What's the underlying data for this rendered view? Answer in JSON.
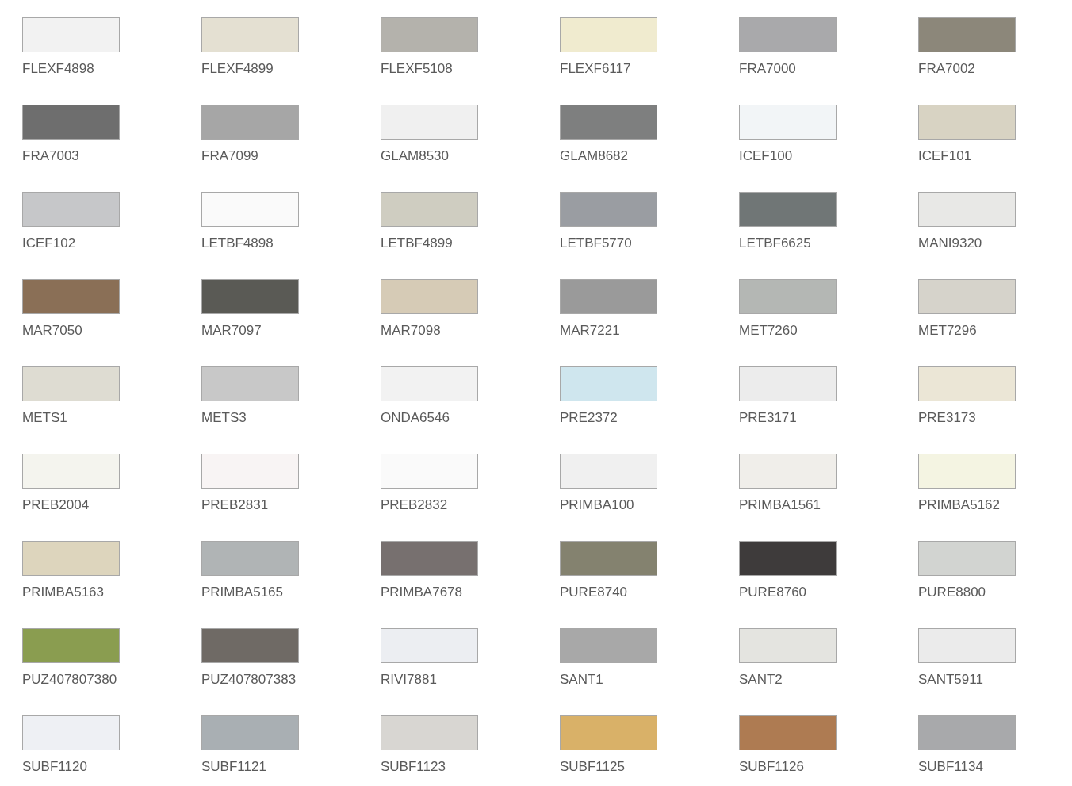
{
  "swatches": [
    {
      "code": "FLEXF4898",
      "color": "#f2f2f2"
    },
    {
      "code": "FLEXF4899",
      "color": "#e4e0d2"
    },
    {
      "code": "FLEXF5108",
      "color": "#b4b2ac"
    },
    {
      "code": "FLEXF6117",
      "color": "#f0ebcf"
    },
    {
      "code": "FRA7000",
      "color": "#a9a9ab"
    },
    {
      "code": "FRA7002",
      "color": "#8c877a"
    },
    {
      "code": "FRA7003",
      "color": "#6e6e6e"
    },
    {
      "code": "FRA7099",
      "color": "#a6a6a6"
    },
    {
      "code": "GLAM8530",
      "color": "#f0f0f0"
    },
    {
      "code": "GLAM8682",
      "color": "#7e7f7f"
    },
    {
      "code": "ICEF100",
      "color": "#f2f5f7"
    },
    {
      "code": "ICEF101",
      "color": "#d8d3c3"
    },
    {
      "code": "ICEF102",
      "color": "#c6c7c9"
    },
    {
      "code": "LETBF4898",
      "color": "#fafafa"
    },
    {
      "code": "LETBF4899",
      "color": "#cfcdc1"
    },
    {
      "code": "LETBF5770",
      "color": "#9a9da2"
    },
    {
      "code": "LETBF6625",
      "color": "#707676"
    },
    {
      "code": "MANI9320",
      "color": "#e8e8e6"
    },
    {
      "code": "MAR7050",
      "color": "#8a6f56"
    },
    {
      "code": "MAR7097",
      "color": "#5a5a55"
    },
    {
      "code": "MAR7098",
      "color": "#d6cbb6"
    },
    {
      "code": "MAR7221",
      "color": "#9a9a9a"
    },
    {
      "code": "MET7260",
      "color": "#b4b7b4"
    },
    {
      "code": "MET7296",
      "color": "#d6d3cb"
    },
    {
      "code": "METS1",
      "color": "#dedcd2"
    },
    {
      "code": "METS3",
      "color": "#c8c8c8"
    },
    {
      "code": "ONDA6546",
      "color": "#f2f2f2"
    },
    {
      "code": "PRE2372",
      "color": "#cfe6ee"
    },
    {
      "code": "PRE3171",
      "color": "#ececec"
    },
    {
      "code": "PRE3173",
      "color": "#ebe6d6"
    },
    {
      "code": "PREB2004",
      "color": "#f4f4ee"
    },
    {
      "code": "PREB2831",
      "color": "#f8f4f4"
    },
    {
      "code": "PREB2832",
      "color": "#fafafa"
    },
    {
      "code": "PRIMBA100",
      "color": "#f0f0f0"
    },
    {
      "code": "PRIMBA1561",
      "color": "#f0eeea"
    },
    {
      "code": "PRIMBA5162",
      "color": "#f4f4e2"
    },
    {
      "code": "PRIMBA5163",
      "color": "#ddd5bd"
    },
    {
      "code": "PRIMBA5165",
      "color": "#b0b4b5"
    },
    {
      "code": "PRIMBA7678",
      "color": "#77706f"
    },
    {
      "code": "PURE8740",
      "color": "#84826f"
    },
    {
      "code": "PURE8760",
      "color": "#3e3b3b"
    },
    {
      "code": "PURE8800",
      "color": "#d2d4d1"
    },
    {
      "code": "PUZ407807380",
      "color": "#8a9d50"
    },
    {
      "code": "PUZ407807383",
      "color": "#6f6a65"
    },
    {
      "code": "RIVI7881",
      "color": "#eceef2"
    },
    {
      "code": "SANT1",
      "color": "#a8a8a8"
    },
    {
      "code": "SANT2",
      "color": "#e4e4e0"
    },
    {
      "code": "SANT5911",
      "color": "#ebebeb"
    },
    {
      "code": "SUBF1120",
      "color": "#eef0f4"
    },
    {
      "code": "SUBF1121",
      "color": "#a9afb3"
    },
    {
      "code": "SUBF1123",
      "color": "#d8d6d2"
    },
    {
      "code": "SUBF1125",
      "color": "#d9b168"
    },
    {
      "code": "SUBF1126",
      "color": "#ae7b52"
    },
    {
      "code": "SUBF1134",
      "color": "#a8a9ab"
    }
  ]
}
